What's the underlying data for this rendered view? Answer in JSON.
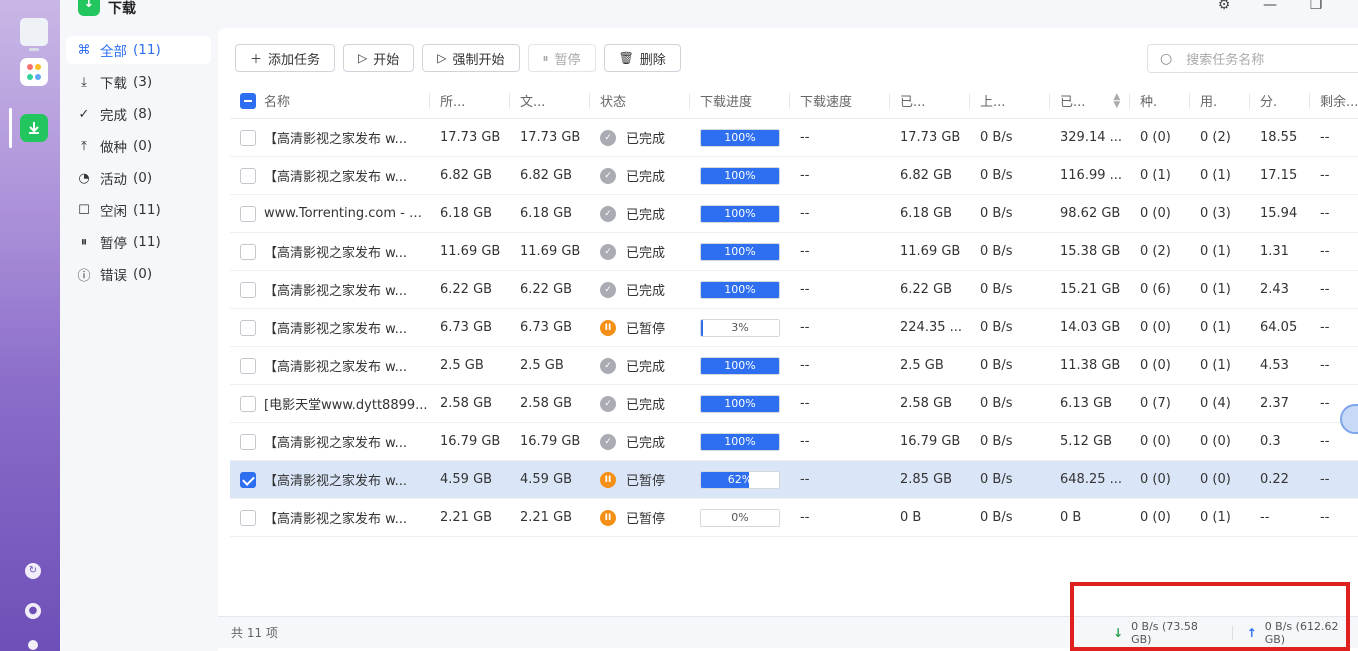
{
  "app": {
    "title": "下载"
  },
  "sidebar": {
    "items": [
      {
        "label": "全部",
        "count": "(11)",
        "icon": "grid-icon"
      },
      {
        "label": "下载",
        "count": "(3)",
        "icon": "download-icon"
      },
      {
        "label": "完成",
        "count": "(8)",
        "icon": "check-circle-icon"
      },
      {
        "label": "做种",
        "count": "(0)",
        "icon": "upload-icon"
      },
      {
        "label": "活动",
        "count": "(0)",
        "icon": "activity-icon"
      },
      {
        "label": "空闲",
        "count": "(11)",
        "icon": "idle-icon"
      },
      {
        "label": "暂停",
        "count": "(11)",
        "icon": "pause-circle-icon"
      },
      {
        "label": "错误",
        "count": "(0)",
        "icon": "error-icon"
      }
    ]
  },
  "toolbar": {
    "add": "添加任务",
    "start": "开始",
    "force_start": "强制开始",
    "pause": "暂停",
    "delete": "删除"
  },
  "search": {
    "placeholder": "搜索任务名称"
  },
  "columns": [
    "名称",
    "所...",
    "文...",
    "状态",
    "下载进度",
    "下载速度",
    "已...",
    "上...",
    "已...",
    "种.",
    "用.",
    "分.",
    "剩余..."
  ],
  "rows": [
    {
      "name": "【高清影视之家发布 w...",
      "size": "17.73 GB",
      "file": "17.73 GB",
      "status": "已完成",
      "state": "done",
      "progress": 100,
      "progress_label": "100%",
      "speed": "--",
      "downloaded": "17.73 GB",
      "up_speed": "0 B/s",
      "uploaded": "329.14 ...",
      "seeds": "0 (0)",
      "peers": "0 (2)",
      "ratio": "18.55",
      "remaining": "--",
      "checked": false
    },
    {
      "name": "【高清影视之家发布 w...",
      "size": "6.82 GB",
      "file": "6.82 GB",
      "status": "已完成",
      "state": "done",
      "progress": 100,
      "progress_label": "100%",
      "speed": "--",
      "downloaded": "6.82 GB",
      "up_speed": "0 B/s",
      "uploaded": "116.99 ...",
      "seeds": "0 (1)",
      "peers": "0 (1)",
      "ratio": "17.15",
      "remaining": "--",
      "checked": false
    },
    {
      "name": "www.Torrenting.com - C...",
      "size": "6.18 GB",
      "file": "6.18 GB",
      "status": "已完成",
      "state": "done",
      "progress": 100,
      "progress_label": "100%",
      "speed": "--",
      "downloaded": "6.18 GB",
      "up_speed": "0 B/s",
      "uploaded": "98.62 GB",
      "seeds": "0 (0)",
      "peers": "0 (3)",
      "ratio": "15.94",
      "remaining": "--",
      "checked": false
    },
    {
      "name": "【高清影视之家发布 w...",
      "size": "11.69 GB",
      "file": "11.69 GB",
      "status": "已完成",
      "state": "done",
      "progress": 100,
      "progress_label": "100%",
      "speed": "--",
      "downloaded": "11.69 GB",
      "up_speed": "0 B/s",
      "uploaded": "15.38 GB",
      "seeds": "0 (2)",
      "peers": "0 (1)",
      "ratio": "1.31",
      "remaining": "--",
      "checked": false
    },
    {
      "name": "【高清影视之家发布 w...",
      "size": "6.22 GB",
      "file": "6.22 GB",
      "status": "已完成",
      "state": "done",
      "progress": 100,
      "progress_label": "100%",
      "speed": "--",
      "downloaded": "6.22 GB",
      "up_speed": "0 B/s",
      "uploaded": "15.21 GB",
      "seeds": "0 (6)",
      "peers": "0 (1)",
      "ratio": "2.43",
      "remaining": "--",
      "checked": false
    },
    {
      "name": "【高清影视之家发布 w...",
      "size": "6.73 GB",
      "file": "6.73 GB",
      "status": "已暂停",
      "state": "paused",
      "progress": 3,
      "progress_label": "3%",
      "speed": "--",
      "downloaded": "224.35 ...",
      "up_speed": "0 B/s",
      "uploaded": "14.03 GB",
      "seeds": "0 (0)",
      "peers": "0 (1)",
      "ratio": "64.05",
      "remaining": "--",
      "checked": false
    },
    {
      "name": "【高清影视之家发布 w...",
      "size": "2.5 GB",
      "file": "2.5 GB",
      "status": "已完成",
      "state": "done",
      "progress": 100,
      "progress_label": "100%",
      "speed": "--",
      "downloaded": "2.5 GB",
      "up_speed": "0 B/s",
      "uploaded": "11.38 GB",
      "seeds": "0 (0)",
      "peers": "0 (1)",
      "ratio": "4.53",
      "remaining": "--",
      "checked": false
    },
    {
      "name": "[电影天堂www.dytt8899...",
      "size": "2.58 GB",
      "file": "2.58 GB",
      "status": "已完成",
      "state": "done",
      "progress": 100,
      "progress_label": "100%",
      "speed": "--",
      "downloaded": "2.58 GB",
      "up_speed": "0 B/s",
      "uploaded": "6.13 GB",
      "seeds": "0 (7)",
      "peers": "0 (4)",
      "ratio": "2.37",
      "remaining": "--",
      "checked": false
    },
    {
      "name": "【高清影视之家发布 w...",
      "size": "16.79 GB",
      "file": "16.79 GB",
      "status": "已完成",
      "state": "done",
      "progress": 100,
      "progress_label": "100%",
      "speed": "--",
      "downloaded": "16.79 GB",
      "up_speed": "0 B/s",
      "uploaded": "5.12 GB",
      "seeds": "0 (0)",
      "peers": "0 (0)",
      "ratio": "0.3",
      "remaining": "--",
      "checked": false
    },
    {
      "name": "【高清影视之家发布 w...",
      "size": "4.59 GB",
      "file": "4.59 GB",
      "status": "已暂停",
      "state": "paused",
      "progress": 62,
      "progress_label": "62%",
      "speed": "--",
      "downloaded": "2.85 GB",
      "up_speed": "0 B/s",
      "uploaded": "648.25 ...",
      "seeds": "0 (0)",
      "peers": "0 (0)",
      "ratio": "0.22",
      "remaining": "--",
      "checked": true
    },
    {
      "name": "【高清影视之家发布 w...",
      "size": "2.21 GB",
      "file": "2.21 GB",
      "status": "已暂停",
      "state": "paused",
      "progress": 0,
      "progress_label": "0%",
      "speed": "--",
      "downloaded": "0 B",
      "up_speed": "0 B/s",
      "uploaded": "0 B",
      "seeds": "0 (0)",
      "peers": "0 (1)",
      "ratio": "--",
      "remaining": "--",
      "checked": false
    }
  ],
  "footer": {
    "total": "共 11 项",
    "download_stat": "0 B/s (73.58 GB)",
    "upload_stat": "0 B/s (612.62 GB)"
  },
  "colors": {
    "accent": "#2d6ff0",
    "success": "#22c55e",
    "paused": "#f59016",
    "highlight": "#e0201e"
  }
}
